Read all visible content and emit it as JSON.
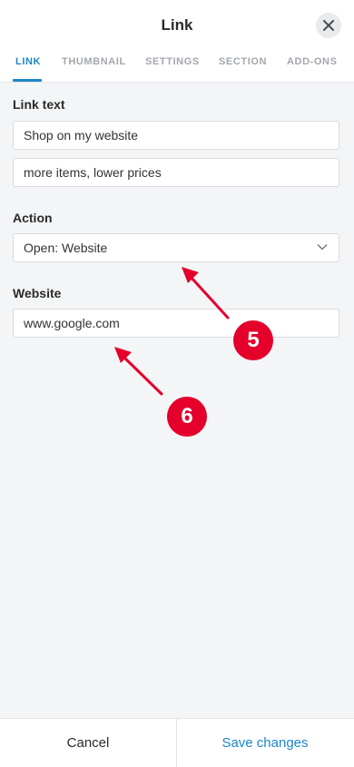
{
  "header": {
    "title": "Link",
    "close_icon": "close-icon"
  },
  "tabs": [
    {
      "label": "LINK",
      "active": true
    },
    {
      "label": "THUMBNAIL",
      "active": false
    },
    {
      "label": "SETTINGS",
      "active": false
    },
    {
      "label": "SECTION",
      "active": false
    },
    {
      "label": "ADD-ONS",
      "active": false
    }
  ],
  "form": {
    "link_text_label": "Link text",
    "link_text_value": "Shop on my website",
    "link_subtext_value": "more items, lower prices",
    "action_label": "Action",
    "action_value": "Open: Website",
    "website_label": "Website",
    "website_value": "www.google.com"
  },
  "annotations": {
    "badge_5": "5",
    "badge_6": "6",
    "color": "#e4002b"
  },
  "footer": {
    "cancel_label": "Cancel",
    "save_label": "Save changes"
  },
  "colors": {
    "accent": "#1d86c8",
    "background": "#f4f5f7"
  }
}
